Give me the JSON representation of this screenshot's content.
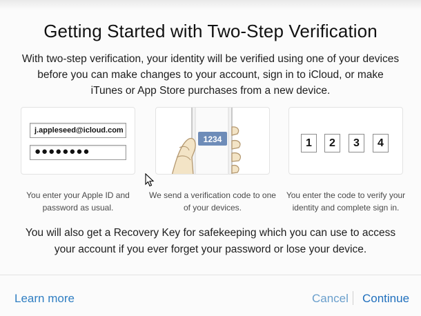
{
  "dialog": {
    "title": "Getting Started with Two-Step Verification",
    "intro": "With two-step verification, your identity will be verified using one of your devices before you can make changes to your account, sign in to iCloud, or make iTunes or App Store purchases from a new device.",
    "steps": [
      {
        "illustration": {
          "email": "j.appleseed@icloud.com",
          "password_mask": "●●●●●●●●"
        },
        "caption": "You enter your Apple ID and password as usual."
      },
      {
        "illustration": {
          "code": "1234"
        },
        "caption": "We send a verification code to one of your devices."
      },
      {
        "illustration": {
          "digits": [
            "1",
            "2",
            "3",
            "4"
          ]
        },
        "caption": "You enter the code to verify your identity and complete sign in."
      }
    ],
    "recovery_text": "You will also get a Recovery Key for safekeeping which you can use to access your account if you ever forget your password or lose your device."
  },
  "footer": {
    "learn_more": "Learn more",
    "cancel": "Cancel",
    "continue": "Continue"
  },
  "colors": {
    "link_blue": "#2f7ec2",
    "cancel_blue": "#6a9fcc",
    "continue_blue": "#1f6fbd",
    "code_badge": "#6e8cb8"
  }
}
